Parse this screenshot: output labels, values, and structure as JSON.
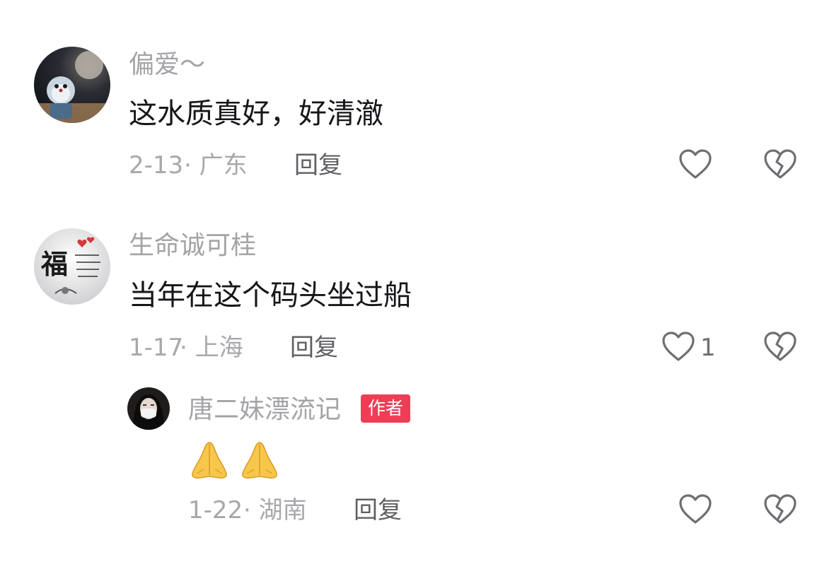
{
  "comments": [
    {
      "username": "偏爱～",
      "content": "这水质真好，好清澈",
      "date": "2-13",
      "region": "· 广东",
      "reply_label": "回复",
      "like_count": ""
    },
    {
      "username": "生命诚可桂",
      "content": "当年在这个码头坐过船",
      "date": "1-17",
      "region": "· 上海",
      "reply_label": "回复",
      "like_count": "1",
      "avatar_text": "福",
      "replies": [
        {
          "username": "唐二妹漂流记",
          "badge": "作者",
          "content_emoji": [
            "folded-hands-emoji",
            "folded-hands-emoji"
          ],
          "date": "1-22",
          "region": "· 湖南",
          "reply_label": "回复"
        }
      ]
    }
  ],
  "colors": {
    "badge": "#ee3e56",
    "username": "#a4a4a8",
    "content": "#16161a",
    "meta": "#a8a8ac"
  }
}
